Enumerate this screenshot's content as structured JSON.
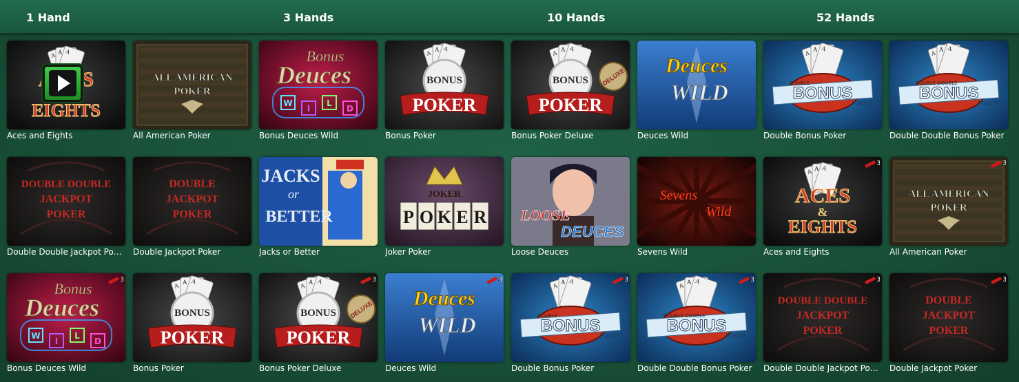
{
  "tabs": [
    {
      "label": "1 Hand"
    },
    {
      "label": "3 Hands"
    },
    {
      "label": "10 Hands"
    },
    {
      "label": "52 Hands"
    }
  ],
  "games": [
    {
      "title": "Aces and Eights",
      "art": "aces-eights",
      "play": true,
      "hands3": false
    },
    {
      "title": "All American Poker",
      "art": "all-american",
      "play": false,
      "hands3": false
    },
    {
      "title": "Bonus Deuces Wild",
      "art": "bonus-deuces",
      "play": false,
      "hands3": false
    },
    {
      "title": "Bonus Poker",
      "art": "bonus-poker",
      "play": false,
      "hands3": false
    },
    {
      "title": "Bonus Poker Deluxe",
      "art": "bonus-poker-deluxe",
      "play": false,
      "hands3": false
    },
    {
      "title": "Deuces Wild",
      "art": "deuces-wild",
      "play": false,
      "hands3": false
    },
    {
      "title": "Double Bonus Poker",
      "art": "double-bonus",
      "play": false,
      "hands3": false
    },
    {
      "title": "Double Double Bonus Poker",
      "art": "double-double-bonus",
      "play": false,
      "hands3": false
    },
    {
      "title": "Double Double Jackpot Poker",
      "art": "ddj-poker",
      "play": false,
      "hands3": false
    },
    {
      "title": "Double Jackpot Poker",
      "art": "dj-poker",
      "play": false,
      "hands3": false
    },
    {
      "title": "Jacks or Better",
      "art": "jacks-better",
      "play": false,
      "hands3": false
    },
    {
      "title": "Joker Poker",
      "art": "joker-poker",
      "play": false,
      "hands3": false
    },
    {
      "title": "Loose Deuces",
      "art": "loose-deuces",
      "play": false,
      "hands3": false
    },
    {
      "title": "Sevens Wild",
      "art": "sevens-wild",
      "play": false,
      "hands3": false
    },
    {
      "title": "Aces and Eights",
      "art": "aces-eights",
      "play": false,
      "hands3": true
    },
    {
      "title": "All American Poker",
      "art": "all-american",
      "play": false,
      "hands3": true
    },
    {
      "title": "Bonus Deuces Wild",
      "art": "bonus-deuces",
      "play": false,
      "hands3": true
    },
    {
      "title": "Bonus Poker",
      "art": "bonus-poker",
      "play": false,
      "hands3": false
    },
    {
      "title": "Bonus Poker Deluxe",
      "art": "bonus-poker-deluxe",
      "play": false,
      "hands3": true
    },
    {
      "title": "Deuces Wild",
      "art": "deuces-wild",
      "play": false,
      "hands3": true
    },
    {
      "title": "Double Bonus Poker",
      "art": "double-bonus",
      "play": false,
      "hands3": true
    },
    {
      "title": "Double Double Bonus Poker",
      "art": "double-double-bonus",
      "play": false,
      "hands3": true
    },
    {
      "title": "Double Double Jackpot Poker",
      "art": "ddj-poker",
      "play": false,
      "hands3": true
    },
    {
      "title": "Double Jackpot Poker",
      "art": "dj-poker",
      "play": false,
      "hands3": true
    }
  ],
  "art_text": {
    "aces_eights_top": "ACES",
    "aces_eights_amp": "&",
    "aces_eights_bottom": "EIGHTS",
    "all_american_1": "ALL AMERICAN",
    "all_american_2": "POKER",
    "bonus_word": "Bonus",
    "deuces_word": "Deuces",
    "wild_letters": [
      "W",
      "I",
      "L",
      "D"
    ],
    "bonus_caps": "BONUS",
    "poker_caps": "POKER",
    "deluxe_caps": "DELUXE",
    "deuces_italic": "Deuces",
    "wild_caps": "WILD",
    "double_caps": "DOUBLE",
    "double_double_caps": "DOUBLE DOUBLE",
    "jackpot_caps": "JACKPOT",
    "poker_small": "POKER",
    "jacks_word": "JACKS",
    "or_word": "or",
    "better_word": "BETTER",
    "joker_word": "JOKER",
    "joker_poker": "POKER",
    "loose_word": "LOOSE",
    "deuces_blue": "DEUCES",
    "sevens_word": "Sevens",
    "wild_word": "Wild",
    "badge_3": "3",
    "card_a": "A"
  },
  "colors": {
    "bg": "#184f37",
    "topbar": "#1f6146",
    "title_text": "#ffffff",
    "red_text": "#c42a22",
    "play_green": "#2fb83a"
  }
}
